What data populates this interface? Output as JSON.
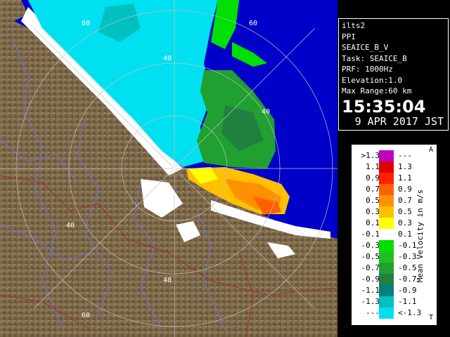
{
  "info": {
    "site": "ilts2",
    "scan_type": "PPI",
    "product": "SEAICE_B_V",
    "task": "Task: SEAICE_B",
    "prf": "PRF: 1000Hz",
    "elevation": "Elevation:1.0",
    "max_range": "Max Range:60 km",
    "time": "15:35:04",
    "date": "9 APR 2017 JST"
  },
  "range_labels": [
    "60",
    "40",
    "40",
    "60",
    "40",
    "40",
    "60"
  ],
  "legend": {
    "title": "Mean Velocity in m/s",
    "top_marker": "A",
    "bottom_marker": "T",
    "rows": [
      {
        "left": ">1.3",
        "right": "---",
        "color": "#c000c0"
      },
      {
        "left": "1.1",
        "right": "1.3",
        "color": "#e00000"
      },
      {
        "left": "0.9",
        "right": "1.1",
        "color": "#ff2000"
      },
      {
        "left": "0.7",
        "right": "0.9",
        "color": "#ff6000"
      },
      {
        "left": "0.5",
        "right": "0.7",
        "color": "#ff9000"
      },
      {
        "left": "0.3",
        "right": "0.5",
        "color": "#ffc000"
      },
      {
        "left": "0.1",
        "right": "0.3",
        "color": "#ffff00"
      },
      {
        "left": "-0.1",
        "right": "0.1",
        "color": "#ffffff"
      },
      {
        "left": "-0.3",
        "right": "-0.1",
        "color": "#00e000"
      },
      {
        "left": "-0.5",
        "right": "-0.3",
        "color": "#20c020"
      },
      {
        "left": "-0.7",
        "right": "-0.5",
        "color": "#20a030"
      },
      {
        "left": "-0.9",
        "right": "-0.7",
        "color": "#208040"
      },
      {
        "left": "-1.1",
        "right": "-0.9",
        "color": "#008080"
      },
      {
        "left": "-1.3",
        "right": "-1.1",
        "color": "#00c0c0"
      },
      {
        "left": "---",
        "right": "<-1.3",
        "color": "#00e0f0"
      }
    ]
  },
  "colors": {
    "sea": "#0000c8",
    "land": "#7a6648",
    "land_light": "#a08a66",
    "rivers": "#7070c0",
    "borders": "#a03030",
    "range_rings": "#c0c0c0"
  }
}
